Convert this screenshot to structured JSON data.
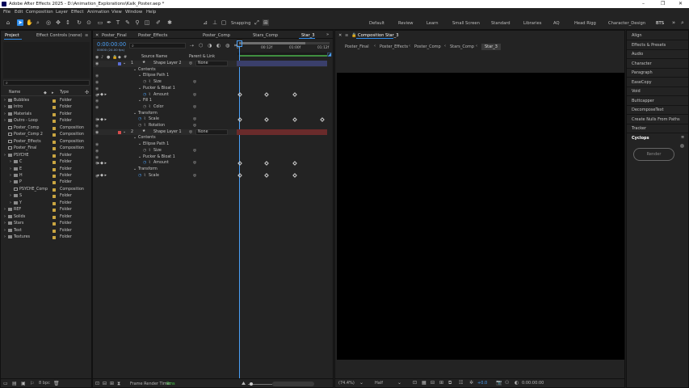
{
  "titlebar": {
    "title": "Adobe After Effects 2025 - D:\\Animation_Explorations\\Kaik_Poster.aep *",
    "min": "–",
    "max": "❐",
    "close": "✕"
  },
  "menu": [
    "File",
    "Edit",
    "Composition",
    "Layer",
    "Effect",
    "Animation",
    "View",
    "Window",
    "Help"
  ],
  "toolbar": {
    "snapping": "Snapping",
    "workspaces": [
      "Default",
      "Review",
      "Learn",
      "Small Screen",
      "Standard",
      "Libraries",
      "AQ",
      "Head Rigg",
      "Character_Design",
      "BTS"
    ],
    "active_workspace": "BTS"
  },
  "project": {
    "tab_project": "Project",
    "tab_effect_controls": "Effect Controls (none)",
    "search_placeholder": "",
    "col_name": "Name",
    "col_type": "Type",
    "items": [
      {
        "name": "Bubbles",
        "type": "Folder",
        "indent": 0,
        "kind": "folder"
      },
      {
        "name": "Intro",
        "type": "Folder",
        "indent": 0,
        "kind": "folder"
      },
      {
        "name": "Materials",
        "type": "Folder",
        "indent": 0,
        "kind": "folder"
      },
      {
        "name": "Outro - Loop",
        "type": "Folder",
        "indent": 0,
        "kind": "folder"
      },
      {
        "name": "Poster_Comp",
        "type": "Composition",
        "indent": 0,
        "kind": "comp"
      },
      {
        "name": "Poster_Comp 2",
        "type": "Composition",
        "indent": 0,
        "kind": "comp"
      },
      {
        "name": "Poster_Effects",
        "type": "Composition",
        "indent": 0,
        "kind": "comp"
      },
      {
        "name": "Poster_Final",
        "type": "Composition",
        "indent": 0,
        "kind": "comp"
      },
      {
        "name": "PSYCHE",
        "type": "Folder",
        "indent": 0,
        "kind": "folder"
      },
      {
        "name": "C",
        "type": "Folder",
        "indent": 1,
        "kind": "folder"
      },
      {
        "name": "E",
        "type": "Folder",
        "indent": 1,
        "kind": "folder"
      },
      {
        "name": "H",
        "type": "Folder",
        "indent": 1,
        "kind": "folder"
      },
      {
        "name": "P",
        "type": "Folder",
        "indent": 1,
        "kind": "folder"
      },
      {
        "name": "PSYCHE_Comp",
        "type": "Composition",
        "indent": 1,
        "kind": "comp"
      },
      {
        "name": "S",
        "type": "Folder",
        "indent": 1,
        "kind": "folder"
      },
      {
        "name": "Y",
        "type": "Folder",
        "indent": 1,
        "kind": "folder"
      },
      {
        "name": "REF",
        "type": "Folder",
        "indent": 0,
        "kind": "folder"
      },
      {
        "name": "Solids",
        "type": "Folder",
        "indent": 0,
        "kind": "folder"
      },
      {
        "name": "Stars",
        "type": "Folder",
        "indent": 0,
        "kind": "folder"
      },
      {
        "name": "Text",
        "type": "Folder",
        "indent": 0,
        "kind": "folder"
      },
      {
        "name": "Textures",
        "type": "Folder",
        "indent": 0,
        "kind": "folder"
      }
    ],
    "bpc": "8 bpc"
  },
  "timeline": {
    "tabs": [
      "Poster_Final",
      "Poster_Effects",
      "Poster_Comp",
      "Stars_Comp",
      "Star_3"
    ],
    "active_tab": "Star_3",
    "timecode": "0:00:00:00",
    "fps": "00000 (24.00 fps)",
    "col_source": "Source Name",
    "col_parent": "Parent & Link",
    "ruler": [
      "0f",
      "00:12f",
      "01:00f",
      "01:12f"
    ],
    "rows": [
      {
        "type": "layer",
        "num": "1",
        "name": "Shape Layer 2",
        "parent": "None",
        "label_color": "#5b6ed6"
      },
      {
        "type": "group",
        "name": "Contents",
        "indent": 1
      },
      {
        "type": "group",
        "name": "Ellipse Path 1",
        "indent": 2
      },
      {
        "type": "prop",
        "name": "Size",
        "indent": 3
      },
      {
        "type": "group",
        "name": "Pucker & Bloat 1",
        "indent": 2
      },
      {
        "type": "prop",
        "name": "Amount",
        "indent": 3,
        "keyed": true
      },
      {
        "type": "group",
        "name": "Fill 1",
        "indent": 2
      },
      {
        "type": "prop",
        "name": "Color",
        "indent": 3
      },
      {
        "type": "group",
        "name": "Transform",
        "indent": 1
      },
      {
        "type": "prop",
        "name": "Scale",
        "indent": 2,
        "keyed": true
      },
      {
        "type": "prop",
        "name": "Rotation",
        "indent": 2
      },
      {
        "type": "layer",
        "num": "2",
        "name": "Shape Layer 1",
        "parent": "None",
        "label_color": "#d84d4d"
      },
      {
        "type": "group",
        "name": "Contents",
        "indent": 1
      },
      {
        "type": "group",
        "name": "Ellipse Path 1",
        "indent": 2
      },
      {
        "type": "prop",
        "name": "Size",
        "indent": 3
      },
      {
        "type": "group",
        "name": "Pucker & Bloat 1",
        "indent": 2
      },
      {
        "type": "prop",
        "name": "Amount",
        "indent": 3,
        "keyed": true
      },
      {
        "type": "group",
        "name": "Transform",
        "indent": 1
      },
      {
        "type": "prop",
        "name": "Scale",
        "indent": 2,
        "keyed": true
      }
    ],
    "frame_render_label": "Frame Render Time:",
    "frame_render_value": "0ms"
  },
  "composition": {
    "title": "Composition Star_3",
    "breadcrumbs": [
      "Poster_Final",
      "Poster_Effects",
      "Poster_Comp",
      "Stars_Comp",
      "Star_3"
    ],
    "zoom": "(74.4%)",
    "resolution": "Half",
    "exposure": "+0.0",
    "timecode": "0:00:00:00"
  },
  "right_panel": {
    "items": [
      "Align",
      "Effects & Presets",
      "Audio",
      "Character",
      "Paragraph",
      "EaseCopy",
      "Void",
      "Buttcapper",
      "DecomposeText",
      "Create Nulls From Paths",
      "Tracker",
      "Cyclops"
    ],
    "render_button": "Render"
  }
}
